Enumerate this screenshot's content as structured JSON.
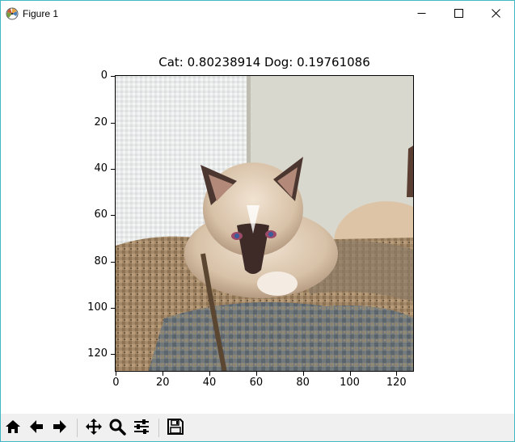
{
  "window": {
    "title": "Figure 1",
    "minimize_icon": "minimize-icon",
    "maximize_icon": "maximize-icon",
    "close_icon": "close-icon",
    "frame_color": "#41b7c4"
  },
  "figure": {
    "title": "Cat: 0.80238914 Dog: 0.19761086",
    "image_description_icon": "cat-photo",
    "y_ticks": [
      "0",
      "20",
      "40",
      "60",
      "80",
      "100",
      "120"
    ],
    "x_ticks": [
      "0",
      "20",
      "40",
      "60",
      "80",
      "100",
      "120"
    ]
  },
  "chart_data": {
    "type": "image",
    "title": "Cat: 0.80238914 Dog: 0.19761086",
    "xlim": [
      0,
      127
    ],
    "ylim": [
      127,
      0
    ],
    "x_ticks": [
      0,
      20,
      40,
      60,
      80,
      100,
      120
    ],
    "y_ticks": [
      0,
      20,
      40,
      60,
      80,
      100,
      120
    ]
  },
  "toolbar": {
    "buttons": [
      {
        "name": "home",
        "icon": "home-icon"
      },
      {
        "name": "back",
        "icon": "back-arrow-icon"
      },
      {
        "name": "forward",
        "icon": "forward-arrow-icon"
      },
      {
        "name": "pan",
        "icon": "pan-move-icon"
      },
      {
        "name": "zoom",
        "icon": "zoom-magnifier-icon"
      },
      {
        "name": "configure-subplots",
        "icon": "subplots-sliders-icon"
      },
      {
        "name": "save",
        "icon": "save-floppy-icon"
      }
    ],
    "background": "#f0f0f0"
  }
}
